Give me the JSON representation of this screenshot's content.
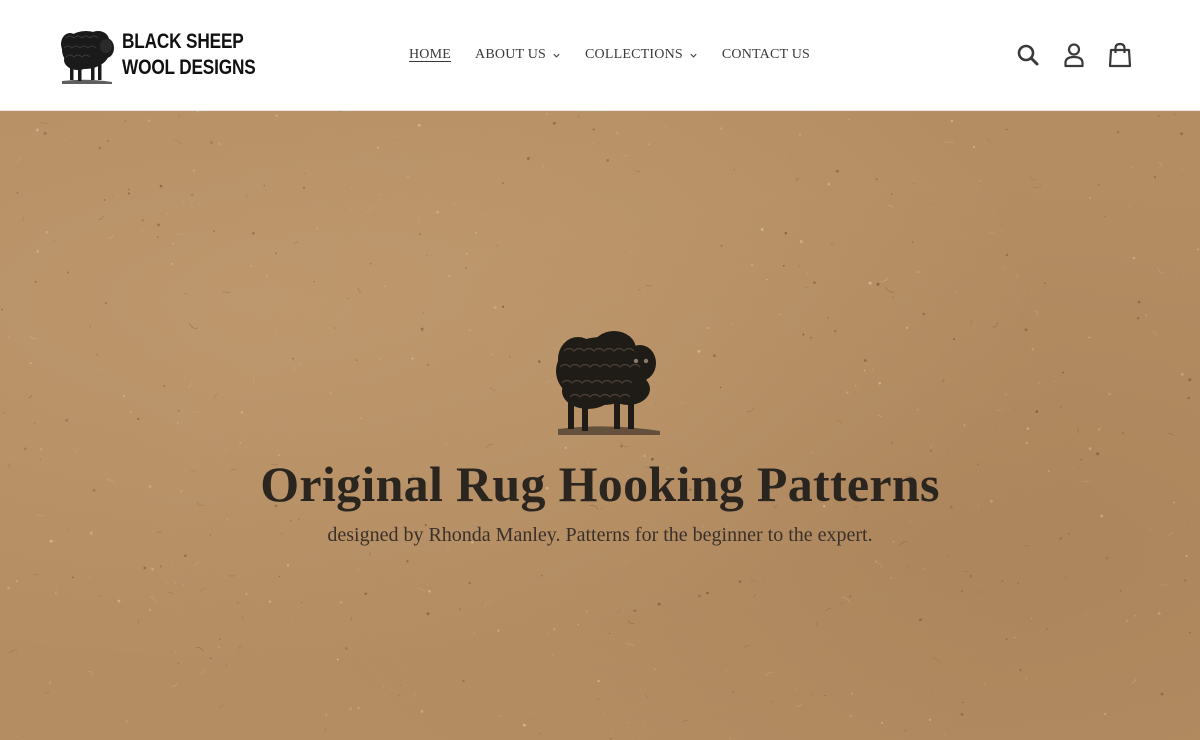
{
  "brand": {
    "line1": "BLACK SHEEP",
    "line2": "WOOL DESIGNS",
    "logo_icon": "black-sheep-logo"
  },
  "nav": {
    "items": [
      {
        "label": "HOME",
        "active": true,
        "has_dropdown": false
      },
      {
        "label": "ABOUT US",
        "active": false,
        "has_dropdown": true
      },
      {
        "label": "COLLECTIONS",
        "active": false,
        "has_dropdown": true
      },
      {
        "label": "CONTACT US",
        "active": false,
        "has_dropdown": false
      }
    ]
  },
  "header_icons": [
    "search-icon",
    "account-icon",
    "cart-icon"
  ],
  "hero": {
    "title": "Original Rug Hooking Patterns",
    "subtitle": "designed by Rhonda Manley. Patterns for the beginner to the expert.",
    "image_icon": "black-sheep-illustration"
  },
  "colors": {
    "kraft_background": "#b58d63",
    "text_dark": "#2b2520",
    "nav_text": "#3a3a3a",
    "header_background": "#ffffff"
  }
}
